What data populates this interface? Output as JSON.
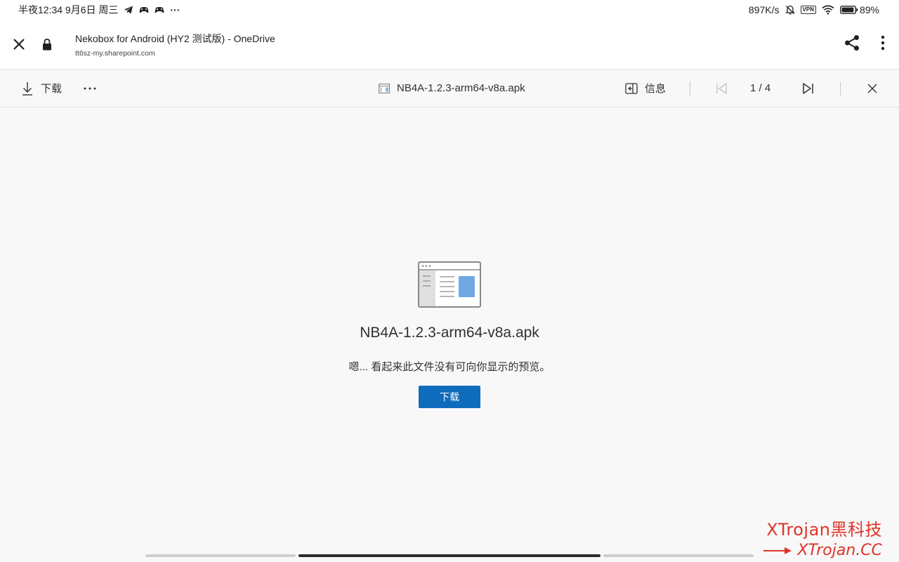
{
  "status_bar": {
    "left_text": "半夜12:34 9月6日 周三",
    "more": "···",
    "net_speed": "897K/s",
    "vpn": "VPN",
    "battery": "89%",
    "icons": [
      "telegram-icon",
      "game-controller-icon",
      "game-controller-icon",
      "bell-muted-icon",
      "vpn-icon",
      "wifi-icon",
      "battery-icon"
    ]
  },
  "browser": {
    "title": "Nekobox for Android (HY2 测试版) - OneDrive",
    "url": "tt6sz-my.sharepoint.com",
    "icons": [
      "close-icon",
      "lock-icon",
      "share-icon",
      "overflow-menu-icon"
    ]
  },
  "toolbar": {
    "download_label": "下载",
    "more_label": "···",
    "file_name": "NB4A-1.2.3-arm64-v8a.apk",
    "info_label": "信息",
    "page_indicator": "1 / 4"
  },
  "preview": {
    "file_name": "NB4A-1.2.3-arm64-v8a.apk",
    "message": "嗯... 看起来此文件没有可向你显示的预览。",
    "download_button": "下载"
  },
  "watermark": {
    "line1": "XTrojan黑科技",
    "line2": "XTrojan.CC"
  },
  "colors": {
    "accent": "#0f6cbd",
    "watermark": "#e0332a"
  }
}
